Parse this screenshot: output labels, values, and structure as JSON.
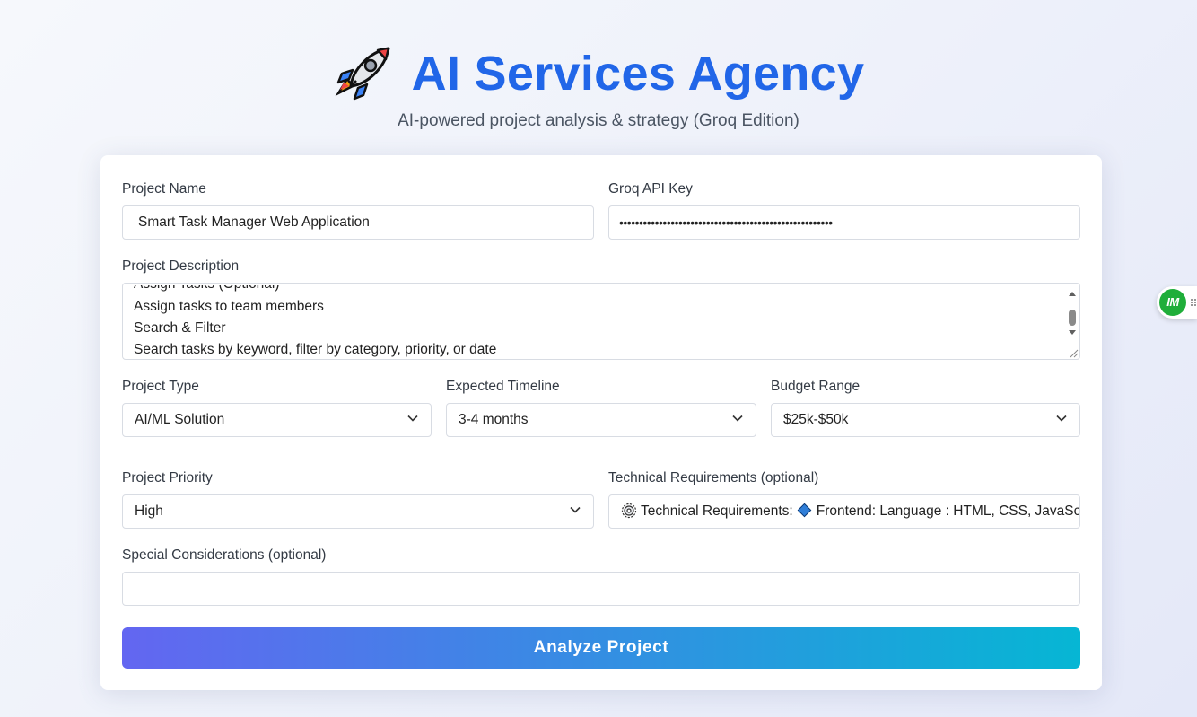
{
  "header": {
    "icon": "rocket-icon",
    "title": "AI Services Agency",
    "subtitle": "AI-powered project analysis & strategy (Groq Edition)"
  },
  "form": {
    "project_name": {
      "label": "Project Name",
      "value": "Smart Task Manager Web Application"
    },
    "api_key": {
      "label": "Groq API Key",
      "value": "••••••••••••••••••••••••••••••••••••••••••••••••••••••"
    },
    "description": {
      "label": "Project Description",
      "visible_lines": [
        "Assign tasks to team members",
        "Search & Filter",
        "Search tasks by keyword, filter by category, priority, or date"
      ],
      "partial_line": "Assign Tasks (Optional)"
    },
    "project_type": {
      "label": "Project Type",
      "value": "AI/ML Solution"
    },
    "timeline": {
      "label": "Expected Timeline",
      "value": "3-4 months"
    },
    "budget": {
      "label": "Budget Range",
      "value": "$25k-$50k"
    },
    "priority": {
      "label": "Project Priority",
      "value": "High"
    },
    "tech_requirements": {
      "label": "Technical Requirements (optional)",
      "value_prefix": "Technical Requirements:",
      "value_rest": "Frontend: Language : HTML, CSS, JavaScript"
    },
    "special": {
      "label": "Special Considerations (optional)",
      "value": ""
    },
    "submit_label": "Analyze Project"
  },
  "extension_badge": {
    "text": "IM"
  },
  "colors": {
    "title": "#2166e8",
    "button_gradient_start": "#6366f1",
    "button_gradient_end": "#06b6d4",
    "extension_green": "#1fae3a"
  }
}
